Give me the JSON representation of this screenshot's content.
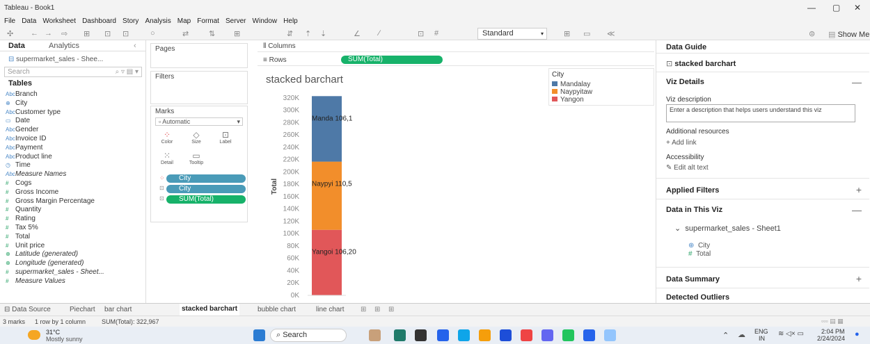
{
  "window": {
    "title": "Tableau - Book1",
    "minimize": "—",
    "restore": "▢",
    "close": "✕"
  },
  "menu": [
    "File",
    "Data",
    "Worksheet",
    "Dashboard",
    "Story",
    "Analysis",
    "Map",
    "Format",
    "Server",
    "Window",
    "Help"
  ],
  "toolbar": {
    "fit": "Standard",
    "show_me": "Show Me"
  },
  "data_pane": {
    "tab_data": "Data",
    "tab_analytics": "Analytics",
    "source": "supermarket_sales - Shee...",
    "search_placeholder": "Search",
    "tables_header": "Tables",
    "dimensions": [
      {
        "icon": "Abc",
        "name": "Branch"
      },
      {
        "icon": "⊕",
        "name": "City"
      },
      {
        "icon": "Abc",
        "name": "Customer type"
      },
      {
        "icon": "▭",
        "name": "Date"
      },
      {
        "icon": "Abc",
        "name": "Gender"
      },
      {
        "icon": "Abc",
        "name": "Invoice ID"
      },
      {
        "icon": "Abc",
        "name": "Payment"
      },
      {
        "icon": "Abc",
        "name": "Product line"
      },
      {
        "icon": "◷",
        "name": "Time"
      },
      {
        "icon": "Abc",
        "name": "Measure Names"
      }
    ],
    "measures": [
      {
        "icon": "#",
        "name": "Cogs"
      },
      {
        "icon": "#",
        "name": "Gross Income"
      },
      {
        "icon": "#",
        "name": "Gross Margin Percentage"
      },
      {
        "icon": "#",
        "name": "Quantity"
      },
      {
        "icon": "#",
        "name": "Rating"
      },
      {
        "icon": "#",
        "name": "Tax 5%"
      },
      {
        "icon": "#",
        "name": "Total"
      },
      {
        "icon": "#",
        "name": "Unit price"
      },
      {
        "icon": "⊕",
        "name": "Latitude (generated)"
      },
      {
        "icon": "⊕",
        "name": "Longitude (generated)"
      },
      {
        "icon": "#",
        "name": "supermarket_sales - Sheet..."
      },
      {
        "icon": "#",
        "name": "Measure Values"
      }
    ]
  },
  "pages_label": "Pages",
  "filters_label": "Filters",
  "marks": {
    "header": "Marks",
    "mark_type": "Automatic",
    "buttons": [
      "Color",
      "Size",
      "Label",
      "Detail",
      "Tooltip"
    ],
    "pills": [
      "City",
      "City",
      "SUM(Total)"
    ]
  },
  "shelves": {
    "columns": "Columns",
    "rows": "Rows",
    "rows_pill": "SUM(Total)"
  },
  "chart_data": {
    "type": "bar",
    "title": "stacked barchart",
    "ylabel": "Total",
    "ylim": [
      0,
      330000
    ],
    "yticks": [
      "0K",
      "20K",
      "40K",
      "60K",
      "80K",
      "100K",
      "120K",
      "140K",
      "160K",
      "180K",
      "200K",
      "220K",
      "240K",
      "260K",
      "280K",
      "300K",
      "320K"
    ],
    "categories": [
      ""
    ],
    "series": [
      {
        "name": "Yangon",
        "values": [
          106200
        ],
        "label": "Yangoi 106,20",
        "color": "#e15759"
      },
      {
        "name": "Naypyitaw",
        "values": [
          110500
        ],
        "label": "Naypyi 110,5",
        "color": "#f28e2b"
      },
      {
        "name": "Mandalay",
        "values": [
          106190
        ],
        "label": "Manda 106,1",
        "color": "#4e79a7"
      }
    ]
  },
  "legend": {
    "title": "City",
    "items": [
      {
        "name": "Mandalay",
        "color": "#4e79a7"
      },
      {
        "name": "Naypyitaw",
        "color": "#f28e2b"
      },
      {
        "name": "Yangon",
        "color": "#e15759"
      }
    ]
  },
  "data_guide": {
    "header": "Data Guide",
    "sheet_name": "stacked barchart",
    "viz_details": "Viz Details",
    "viz_description_label": "Viz description",
    "viz_description_placeholder": "Enter a description that helps users understand this viz",
    "additional_resources": "Additional resources",
    "add_link": "Add link",
    "accessibility": "Accessibility",
    "edit_alt_text": "Edit alt text",
    "applied_filters": "Applied Filters",
    "data_in_viz": "Data in This Viz",
    "source_name": "supermarket_sales - Sheet1",
    "fields": [
      "City",
      "Total"
    ],
    "data_summary": "Data Summary",
    "detected_outliers": "Detected Outliers"
  },
  "sheet_tabs": [
    "Data Source",
    "Piechart",
    "bar chart",
    "stacked barchart",
    "bubble chart",
    "line chart"
  ],
  "active_tab": "stacked barchart",
  "status": {
    "marks": "3 marks",
    "layout": "1 row by 1 column",
    "sum": "SUM(Total): 322,967"
  },
  "taskbar": {
    "weather_temp": "31°C",
    "weather_desc": "Mostly sunny",
    "search": "Search",
    "lang": "ENG",
    "region": "IN",
    "time": "2:04 PM",
    "date": "2/24/2024"
  }
}
